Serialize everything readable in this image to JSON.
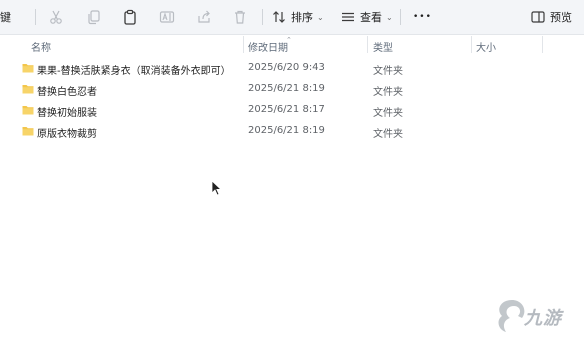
{
  "toolbar": {
    "new_partial": "键",
    "sort_label": "排序",
    "view_label": "查看",
    "more_label": "•••",
    "preview_label": "预览"
  },
  "columns": {
    "name": "名称",
    "date": "修改日期",
    "type": "类型",
    "size": "大小"
  },
  "files": [
    {
      "name": "果果-替换活肤紧身衣（取消装备外衣即可）",
      "date": "2025/6/20 9:43",
      "type": "文件夹",
      "size": ""
    },
    {
      "name": "替换白色忍者",
      "date": "2025/6/21 8:19",
      "type": "文件夹",
      "size": ""
    },
    {
      "name": "替换初始服装",
      "date": "2025/6/21 8:17",
      "type": "文件夹",
      "size": ""
    },
    {
      "name": "原版衣物裁剪",
      "date": "2025/6/21 8:19",
      "type": "文件夹",
      "size": ""
    }
  ],
  "watermark": {
    "text": "九游"
  },
  "colors": {
    "folder": "#f3c64b",
    "toolbar_bg": "#f3f5f8"
  }
}
